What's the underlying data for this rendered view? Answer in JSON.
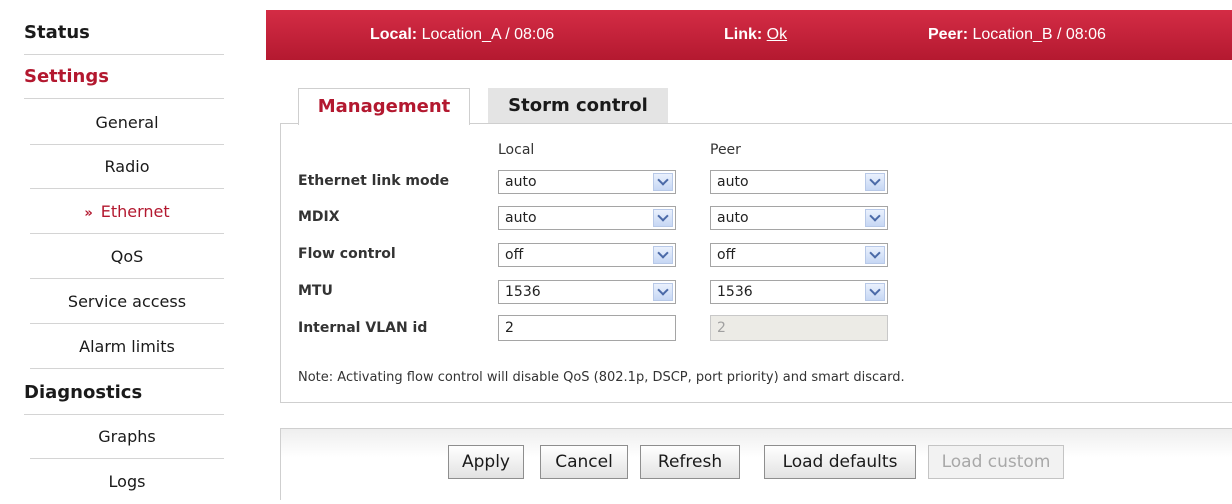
{
  "sidebar": {
    "status": "Status",
    "settings": "Settings",
    "settings_items": [
      "General",
      "Radio",
      "Ethernet",
      "QoS",
      "Service access",
      "Alarm limits"
    ],
    "active_arrow": "»",
    "diagnostics": "Diagnostics",
    "diagnostics_items": [
      "Graphs",
      "Logs"
    ]
  },
  "statusbar": {
    "local_label": "Local:",
    "local_value": "Location_A / 08:06",
    "link_label": "Link:",
    "link_value": "Ok",
    "peer_label": "Peer:",
    "peer_value": "Location_B / 08:06"
  },
  "tabs": [
    "Management",
    "Storm control"
  ],
  "form": {
    "col_local": "Local",
    "col_peer": "Peer",
    "rows": [
      {
        "label": "Ethernet link mode",
        "local": "auto",
        "peer": "auto"
      },
      {
        "label": "MDIX",
        "local": "auto",
        "peer": "auto"
      },
      {
        "label": "Flow control",
        "local": "off",
        "peer": "off"
      },
      {
        "label": "MTU",
        "local": "1536",
        "peer": "1536"
      },
      {
        "label": "Internal VLAN id",
        "local": "2",
        "peer": "2"
      }
    ],
    "note": "Note: Activating flow control will disable QoS (802.1p, DSCP, port priority) and smart discard."
  },
  "buttons": {
    "apply": "Apply",
    "cancel": "Cancel",
    "refresh": "Refresh",
    "load_defaults": "Load defaults",
    "load_custom": "Load custom"
  },
  "colors": {
    "brand_red": "#b41930",
    "active_text": "#b3182f"
  }
}
